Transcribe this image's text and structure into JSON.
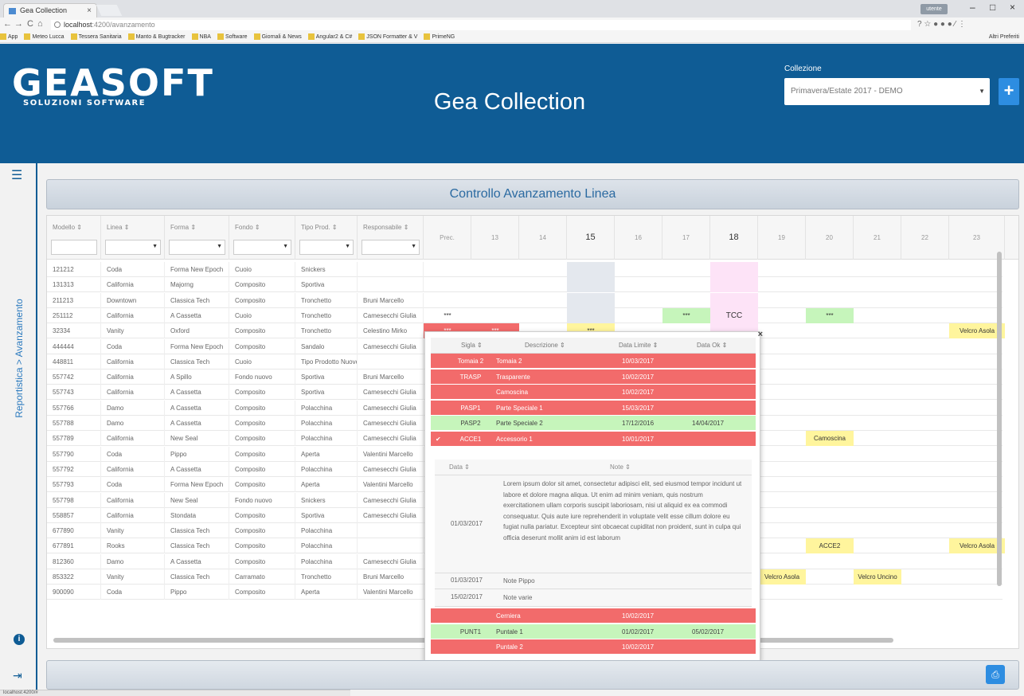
{
  "browser": {
    "tab_title": "Gea Collection",
    "tab_close": "×",
    "url_host": "localhost",
    "url_rest": ":4200/avanzamento",
    "account": "utente",
    "win_min": "–",
    "win_max": "□",
    "win_close": "×",
    "nav_back": "←",
    "nav_forward": "→",
    "nav_reload": "C",
    "nav_home": "⌂",
    "ext_icons": "? ☆ ● ● ● ⁄ ⋮",
    "bookmarks": [
      "App",
      "Meteo Lucca",
      "Tessera Sanitaria",
      "Manto & Bugtracker",
      "NBA",
      "Software",
      "Giornali & News",
      "Angular2 & C#",
      "JSON Formatter & V",
      "PrimeNG"
    ],
    "bookmarks_right": "Altri Preferiti"
  },
  "header": {
    "logo_main": "GEASOFT",
    "logo_sub": "SOLUZIONI SOFTWARE",
    "title": "Gea Collection",
    "collection_label": "Collezione",
    "collection_value": "Primavera/Estate 2017 - DEMO",
    "collection_arrow": "▼",
    "add_button": "+"
  },
  "sidebar": {
    "menu_icon": "☰",
    "breadcrumb": "Reportistica > Avanzamento",
    "info_icon": "i",
    "logout_icon": "⇥"
  },
  "panel": {
    "title": "Controllo Avanzamento Linea"
  },
  "grid": {
    "columns": [
      {
        "label": "Modello ⇕",
        "filter": false
      },
      {
        "label": "Linea ⇕",
        "filter": true
      },
      {
        "label": "Forma ⇕",
        "filter": true
      },
      {
        "label": "Fondo ⇕",
        "filter": true
      },
      {
        "label": "Tipo Prod. ⇕",
        "filter": true
      },
      {
        "label": "Responsabile ⇕",
        "filter": true
      }
    ],
    "days": [
      "Prec.",
      "13",
      "14",
      "15",
      "16",
      "17",
      "18",
      "19",
      "20",
      "21",
      "22",
      "23"
    ],
    "bold_days": [
      3,
      6
    ],
    "rows": [
      {
        "cells": [
          "121212",
          "Coda",
          "Forma New Epoch",
          "Cuoio",
          "Snickers",
          ""
        ]
      },
      {
        "cells": [
          "131313",
          "California",
          "Majorng",
          "Composito",
          "Sportiva",
          ""
        ]
      },
      {
        "cells": [
          "211213",
          "Downtown",
          "Classica Tech",
          "Composito",
          "Tronchetto",
          "Bruni Marcello"
        ]
      },
      {
        "cells": [
          "251112",
          "California",
          "A Cassetta",
          "Cuoio",
          "Tronchetto",
          "Camesecchi Giulia"
        ]
      },
      {
        "cells": [
          "32334",
          "Vanity",
          "Oxford",
          "Composito",
          "Tronchetto",
          "Celestino Mirko"
        ]
      },
      {
        "cells": [
          "444444",
          "Coda",
          "Forma New Epoch",
          "Composito",
          "Sandalo",
          "Camesecchi Giulia"
        ]
      },
      {
        "cells": [
          "448811",
          "California",
          "Classica Tech",
          "Cuoio",
          "Tipo Prodotto Nuovo",
          ""
        ]
      },
      {
        "cells": [
          "557742",
          "California",
          "A Spillo",
          "Fondo nuovo",
          "Sportiva",
          "Bruni Marcello"
        ]
      },
      {
        "cells": [
          "557743",
          "California",
          "A Cassetta",
          "Composito",
          "Sportiva",
          "Camesecchi Giulia"
        ]
      },
      {
        "cells": [
          "557766",
          "Damo",
          "A Cassetta",
          "Composito",
          "Polacchina",
          "Camesecchi Giulia"
        ]
      },
      {
        "cells": [
          "557788",
          "Damo",
          "A Cassetta",
          "Composito",
          "Polacchina",
          "Camesecchi Giulia"
        ]
      },
      {
        "cells": [
          "557789",
          "California",
          "New Seal",
          "Composito",
          "Polacchina",
          "Camesecchi Giulia"
        ]
      },
      {
        "cells": [
          "557790",
          "Coda",
          "Pippo",
          "Composito",
          "Aperta",
          "Valentini Marcello"
        ]
      },
      {
        "cells": [
          "557792",
          "California",
          "A Cassetta",
          "Composito",
          "Polacchina",
          "Camesecchi Giulia"
        ]
      },
      {
        "cells": [
          "557793",
          "Coda",
          "Forma New Epoch",
          "Composito",
          "Aperta",
          "Valentini Marcello"
        ]
      },
      {
        "cells": [
          "557798",
          "California",
          "New Seal",
          "Fondo nuovo",
          "Snickers",
          "Camesecchi Giulia"
        ]
      },
      {
        "cells": [
          "558857",
          "California",
          "Stondata",
          "Composito",
          "Sportiva",
          "Camesecchi Giulia"
        ]
      },
      {
        "cells": [
          "677890",
          "Vanity",
          "Classica Tech",
          "Composito",
          "Polacchina",
          ""
        ]
      },
      {
        "cells": [
          "677891",
          "Rooks",
          "Classica Tech",
          "Composito",
          "Polacchina",
          ""
        ]
      },
      {
        "cells": [
          "812360",
          "Damo",
          "A Cassetta",
          "Composito",
          "Polacchina",
          "Camesecchi Giulia"
        ]
      },
      {
        "cells": [
          "853322",
          "Vanity",
          "Classica Tech",
          "Carramato",
          "Tronchetto",
          "Bruni Marcello"
        ]
      },
      {
        "cells": [
          "900090",
          "Coda",
          "Pippo",
          "Composito",
          "Aperta",
          "Valentini Marcello"
        ]
      }
    ],
    "marks": [
      {
        "row": 3,
        "day": 0,
        "text": "***",
        "color": ""
      },
      {
        "row": 3,
        "day": 5,
        "text": "***",
        "color": "green"
      },
      {
        "row": 3,
        "day": 6,
        "text": "TCC",
        "color": ""
      },
      {
        "row": 3,
        "day": 8,
        "text": "***",
        "color": "green"
      },
      {
        "row": 4,
        "day": 0,
        "text": "***",
        "color": "red"
      },
      {
        "row": 4,
        "day": 1,
        "text": "***",
        "color": "red"
      },
      {
        "row": 4,
        "day": 3,
        "text": "***",
        "color": "yellow"
      },
      {
        "row": 4,
        "day": 11,
        "text": "Velcro Asola",
        "color": "yellow"
      },
      {
        "row": 11,
        "day": 8,
        "text": "Camoscina",
        "color": "yellow"
      },
      {
        "row": 18,
        "day": 8,
        "text": "ACCE2",
        "color": "yellow"
      },
      {
        "row": 18,
        "day": 11,
        "text": "Velcro Asola",
        "color": "yellow"
      },
      {
        "row": 20,
        "day": 7,
        "text": "Velcro Asola",
        "color": "yellow"
      },
      {
        "row": 20,
        "day": 9,
        "text": "Velcro Uncino",
        "color": "yellow"
      }
    ]
  },
  "popup": {
    "close": "×",
    "headers": [
      "Sigla ⇕",
      "Descrizione ⇕",
      "Data Limite ⇕",
      "Data Ok ⇕"
    ],
    "rows_top": [
      {
        "sigla": "Tomaia 2",
        "descr": "Tomaia 2",
        "limite": "10/03/2017",
        "ok": "",
        "color": "red"
      },
      {
        "sigla": "TRASP",
        "descr": "Trasparente",
        "limite": "10/02/2017",
        "ok": "",
        "color": "red"
      },
      {
        "sigla": "",
        "descr": "Camoscina",
        "limite": "10/02/2017",
        "ok": "",
        "color": "red"
      },
      {
        "sigla": "PASP1",
        "descr": "Parte Speciale 1",
        "limite": "15/03/2017",
        "ok": "",
        "color": "red"
      },
      {
        "sigla": "PASP2",
        "descr": "Parte Speciale 2",
        "limite": "17/12/2016",
        "ok": "14/04/2017",
        "color": "green"
      },
      {
        "sigla": "ACCE1",
        "descr": "Accessorio 1",
        "limite": "10/01/2017",
        "ok": "",
        "color": "red",
        "expanded": true
      }
    ],
    "expand_icon": "✔",
    "sub_headers": [
      "Data ⇕",
      "Note ⇕"
    ],
    "sub_rows": [
      {
        "date": "01/03/2017",
        "note": "Lorem ipsum dolor sit amet, consectetur adipisci elit, sed eiusmod tempor incidunt ut labore et dolore magna aliqua. Ut enim ad minim veniam, quis nostrum exercitationem ullam corporis suscipit laboriosam, nisi ut aliquid ex ea commodi consequatur. Quis aute iure reprehenderit in voluptate velit esse cillum dolore eu fugiat nulla pariatur. Excepteur sint obcaecat cupiditat non proident, sunt in culpa qui officia deserunt mollit anim id est laborum"
      },
      {
        "date": "01/03/2017",
        "note": "Note Pippo"
      },
      {
        "date": "15/02/2017",
        "note": "Note varie"
      }
    ],
    "rows_bottom": [
      {
        "sigla": "",
        "descr": "Cerniera",
        "limite": "10/02/2017",
        "ok": "",
        "color": "red"
      },
      {
        "sigla": "PUNT1",
        "descr": "Puntale 1",
        "limite": "01/02/2017",
        "ok": "05/02/2017",
        "color": "green"
      },
      {
        "sigla": "",
        "descr": "Puntale 2",
        "limite": "10/02/2017",
        "ok": "",
        "color": "red"
      }
    ]
  },
  "footer": {
    "print_icon": "⎙"
  },
  "status": "localhost:4200/#"
}
